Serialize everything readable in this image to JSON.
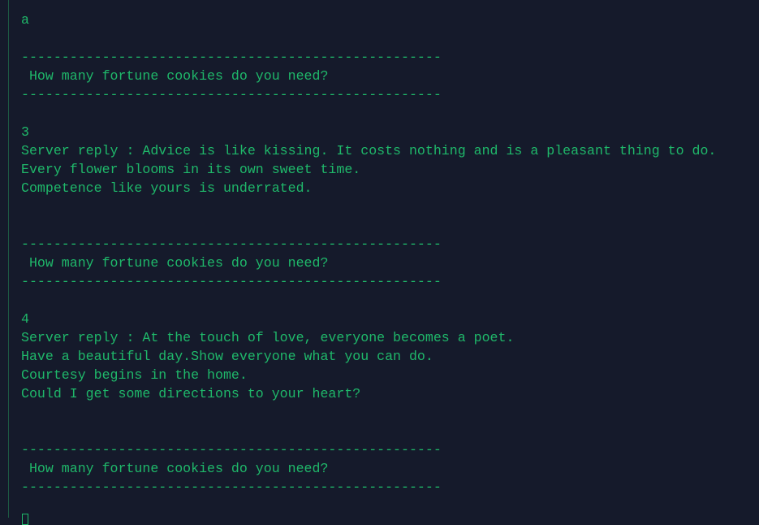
{
  "terminal": {
    "lines": [
      "a",
      "",
      "----------------------------------------------------",
      " How many fortune cookies do you need?",
      "----------------------------------------------------",
      "",
      "3",
      "Server reply : Advice is like kissing. It costs nothing and is a pleasant thing to do.",
      "Every flower blooms in its own sweet time.",
      "Competence like yours is underrated.",
      "",
      "",
      "----------------------------------------------------",
      " How many fortune cookies do you need?",
      "----------------------------------------------------",
      "",
      "4",
      "Server reply : At the touch of love, everyone becomes a poet.",
      "Have a beautiful day.Show everyone what you can do.",
      "Courtesy begins in the home.",
      "Could I get some directions to your heart?",
      "",
      "",
      "----------------------------------------------------",
      " How many fortune cookies do you need?",
      "----------------------------------------------------"
    ],
    "text_color": "#1fb86a",
    "background": "#151a2b"
  }
}
